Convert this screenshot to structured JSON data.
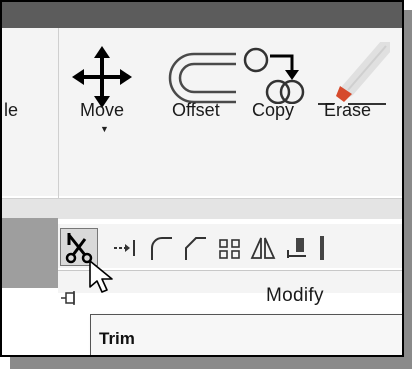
{
  "ribbon": {
    "partial_left_label": "le",
    "tools": [
      {
        "label": "Move",
        "icon": "move-arrows-icon"
      },
      {
        "label": "Offset",
        "icon": "offset-icon"
      },
      {
        "label": "Copy",
        "icon": "copy-icon"
      },
      {
        "label": "Erase",
        "icon": "erase-icon"
      }
    ],
    "small_tools": [
      {
        "icon": "trim-scissors-icon"
      },
      {
        "icon": "extend-icon"
      },
      {
        "icon": "fillet-icon"
      },
      {
        "icon": "chamfer-icon"
      },
      {
        "icon": "array-icon"
      },
      {
        "icon": "mirror-icon"
      },
      {
        "icon": "stretch-icon"
      }
    ],
    "panel_label": "Modify"
  },
  "tooltip": {
    "title": "Trim"
  },
  "colors": {
    "topbar": "#5c5c5c",
    "ribbon": "#f4f4f4",
    "pencil": "#d64a2c"
  }
}
